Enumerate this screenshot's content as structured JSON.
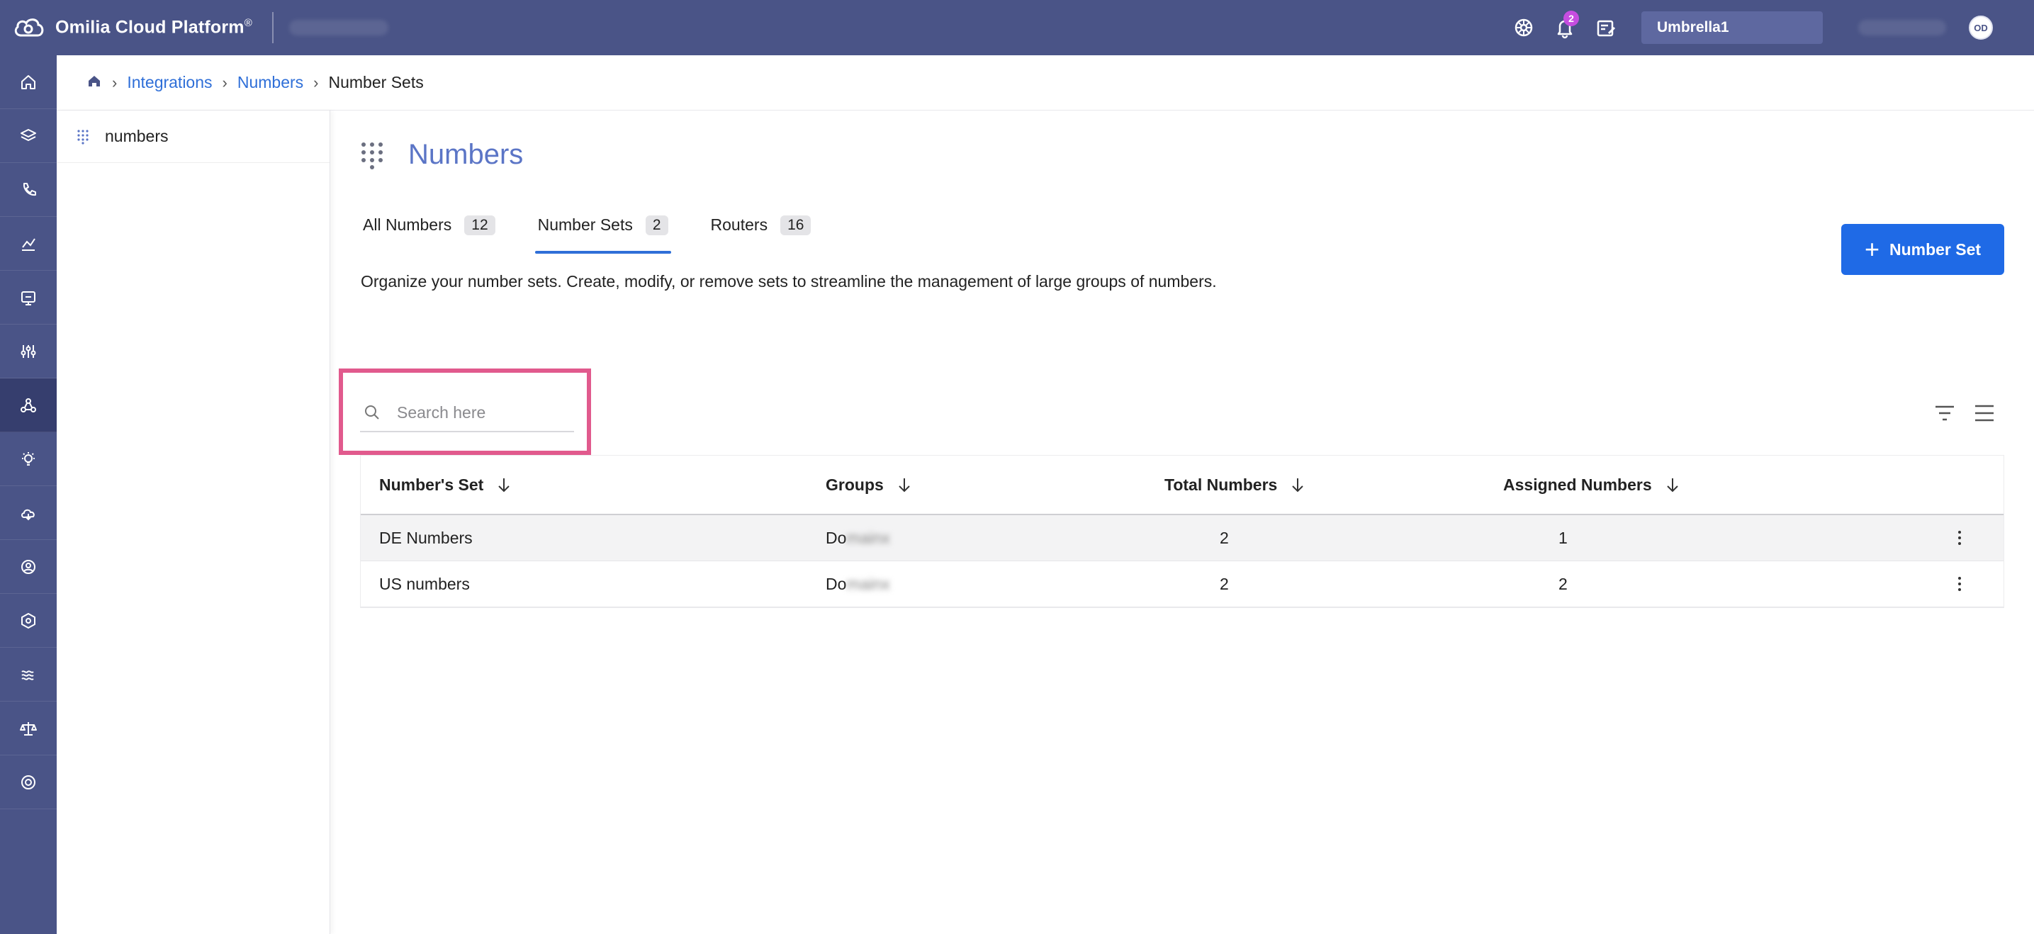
{
  "app": {
    "name": "Omilia Cloud Platform",
    "trademark": "®",
    "notification_count": "2",
    "tenant": "Umbrella1",
    "user_initials": "OD"
  },
  "breadcrumb": {
    "items": [
      "Integrations",
      "Numbers"
    ],
    "current": "Number Sets"
  },
  "subnav": {
    "item_label": "numbers"
  },
  "page": {
    "title": "Numbers",
    "description": "Organize your number sets. Create, modify, or remove sets to streamline the management of large groups of numbers.",
    "add_button_label": "Number Set"
  },
  "tabs": [
    {
      "label": "All Numbers",
      "count": "12",
      "active": false
    },
    {
      "label": "Number Sets",
      "count": "2",
      "active": true
    },
    {
      "label": "Routers",
      "count": "16",
      "active": false
    }
  ],
  "search": {
    "placeholder": "Search here",
    "value": ""
  },
  "table": {
    "columns": [
      "Number's Set",
      "Groups",
      "Total Numbers",
      "Assigned Numbers"
    ],
    "rows": [
      {
        "name": "DE Numbers",
        "group": "Do",
        "total": "2",
        "assigned": "1"
      },
      {
        "name": "US numbers",
        "group": "Do",
        "total": "2",
        "assigned": "2"
      }
    ]
  },
  "colors": {
    "nav_bg": "#4a5487",
    "nav_active": "#363e6e",
    "accent": "#1f6ae6",
    "link": "#2f6fd8",
    "title": "#5b75c6",
    "highlight": "#e15a8d",
    "badge": "#c64de0"
  },
  "icons": {
    "rail": [
      "home-icon",
      "layers-icon",
      "phone-icon",
      "analytics-icon",
      "monitor-icon",
      "sliders-icon",
      "integrations-icon",
      "lightbulb-icon",
      "cloud-icon",
      "user-circle-icon",
      "shield-icon",
      "waves-icon",
      "balance-icon",
      "globe-icon"
    ]
  }
}
